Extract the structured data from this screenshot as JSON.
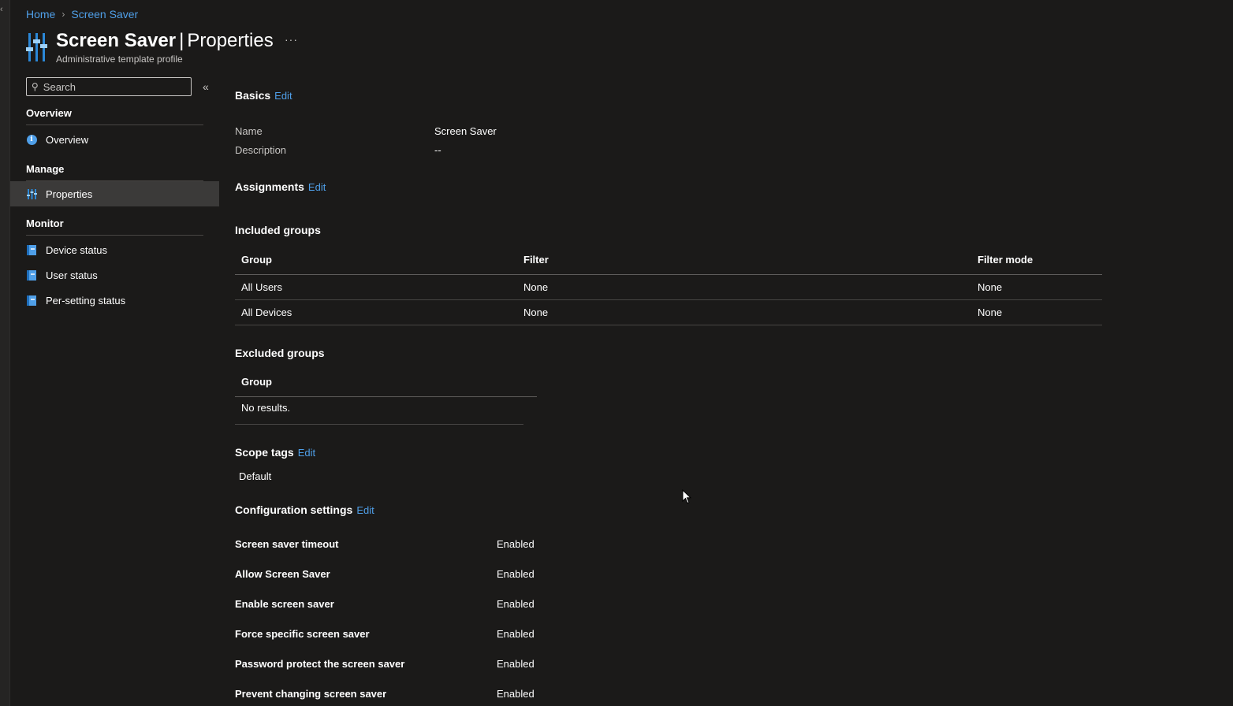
{
  "breadcrumb": {
    "home": "Home",
    "current": "Screen Saver"
  },
  "header": {
    "title_main": "Screen Saver",
    "title_divider": "|",
    "title_sub": "Properties",
    "subtitle": "Administrative template profile",
    "more": "···"
  },
  "sidebar": {
    "search_placeholder": "Search",
    "collapse": "«",
    "sections": {
      "overview": {
        "title": "Overview",
        "item": "Overview"
      },
      "manage": {
        "title": "Manage",
        "item": "Properties"
      },
      "monitor": {
        "title": "Monitor",
        "items": [
          "Device status",
          "User status",
          "Per-setting status"
        ]
      }
    }
  },
  "basics": {
    "title": "Basics",
    "edit": "Edit",
    "name_label": "Name",
    "name_value": "Screen Saver",
    "desc_label": "Description",
    "desc_value": "--"
  },
  "assignments": {
    "title": "Assignments",
    "edit": "Edit",
    "included_title": "Included groups",
    "included_headers": [
      "Group",
      "Filter",
      "Filter mode"
    ],
    "included_rows": [
      [
        "All Users",
        "None",
        "None"
      ],
      [
        "All Devices",
        "None",
        "None"
      ]
    ],
    "excluded_title": "Excluded groups",
    "excluded_header": "Group",
    "excluded_empty": "No results."
  },
  "scope_tags": {
    "title": "Scope tags",
    "edit": "Edit",
    "value": "Default"
  },
  "configuration": {
    "title": "Configuration settings",
    "edit": "Edit",
    "settings": [
      {
        "name": "Screen saver timeout",
        "value": "Enabled"
      },
      {
        "name": "Allow Screen Saver",
        "value": "Enabled"
      },
      {
        "name": "Enable screen saver",
        "value": "Enabled"
      },
      {
        "name": "Force specific screen saver",
        "value": "Enabled"
      },
      {
        "name": "Password protect the screen saver",
        "value": "Enabled"
      },
      {
        "name": "Prevent changing screen saver",
        "value": "Enabled"
      }
    ]
  },
  "colors": {
    "background": "#1b1a19",
    "link": "#4f9fe8",
    "active_nav": "#3b3a39"
  },
  "icons": [
    "chevron-left-icon",
    "breadcrumb-chevron-icon",
    "properties-sliders-icon",
    "search-icon",
    "collapse-icon",
    "info-icon",
    "book-icon",
    "mouse-cursor-icon"
  ]
}
